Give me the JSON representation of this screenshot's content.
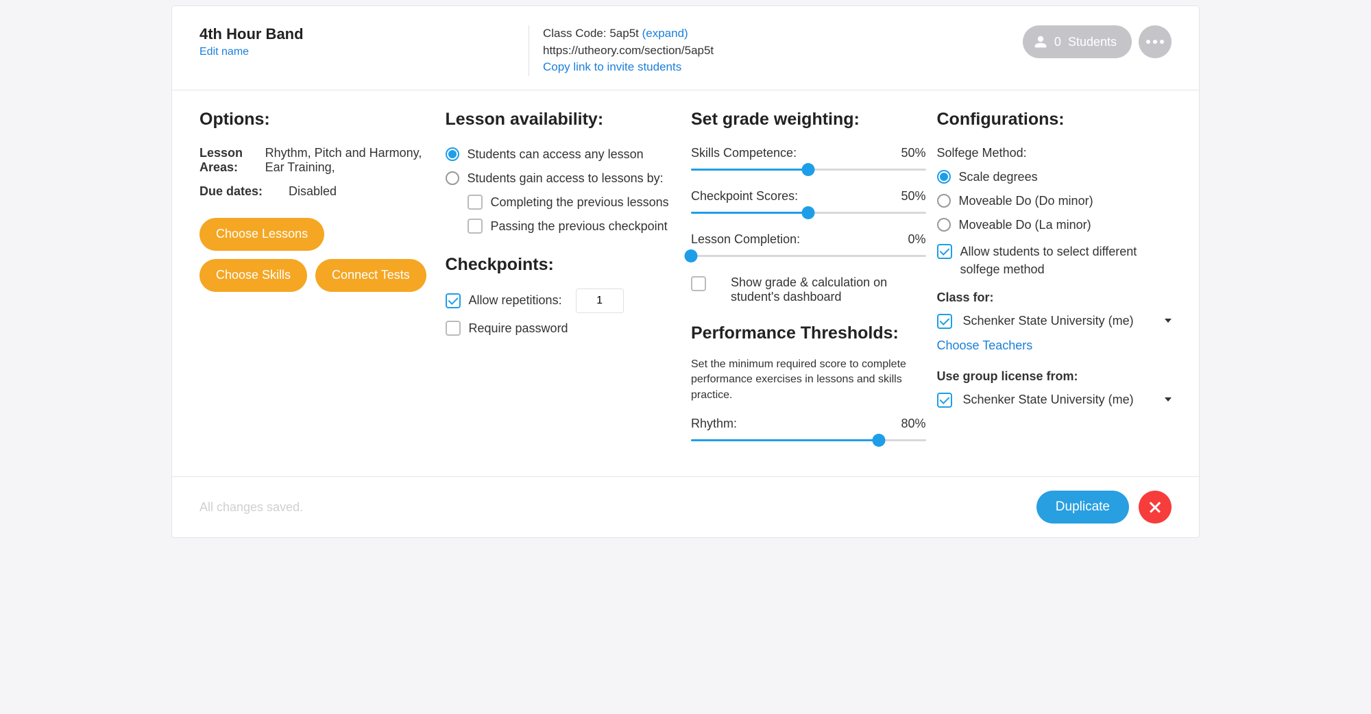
{
  "header": {
    "title": "4th Hour Band",
    "edit_name": "Edit name",
    "class_code_prefix": "Class Code: ",
    "class_code": "5ap5t",
    "expand": "(expand)",
    "url": "https://utheory.com/section/5ap5t",
    "copy_link": "Copy link to invite students",
    "students_count": "0",
    "students_label": "Students"
  },
  "options": {
    "heading": "Options:",
    "lesson_areas_label": "Lesson Areas:",
    "lesson_areas_value": "Rhythm, Pitch and Harmony, Ear Training,",
    "due_dates_label": "Due dates:",
    "due_dates_value": "Disabled",
    "choose_lessons": "Choose Lessons",
    "choose_skills": "Choose Skills",
    "connect_tests": "Connect Tests"
  },
  "availability": {
    "heading": "Lesson availability:",
    "opt_any": "Students can access any lesson",
    "opt_gain": "Students gain access to lessons by:",
    "sub_completing": "Completing the previous lessons",
    "sub_passing": "Passing the previous checkpoint",
    "checkpoints_heading": "Checkpoints:",
    "allow_repetitions": "Allow repetitions:",
    "repetitions_value": "1",
    "require_password": "Require password"
  },
  "grading": {
    "heading": "Set grade weighting:",
    "skills_label": "Skills Competence:",
    "skills_value": "50%",
    "skills_pct": 50,
    "checkpoint_label": "Checkpoint Scores:",
    "checkpoint_value": "50%",
    "checkpoint_pct": 50,
    "lesson_label": "Lesson Completion:",
    "lesson_value": "0%",
    "lesson_pct": 0,
    "show_grade": "Show grade & calculation on student's dashboard",
    "perf_heading": "Performance Thresholds:",
    "perf_desc": "Set the minimum required score to complete performance exercises in lessons and skills practice.",
    "rhythm_label": "Rhythm:",
    "rhythm_value": "80%",
    "rhythm_pct": 80
  },
  "config": {
    "heading": "Configurations:",
    "solfege_label": "Solfege Method:",
    "scale_degrees": "Scale degrees",
    "moveable_do_do": "Moveable Do (Do minor)",
    "moveable_do_la": "Moveable Do (La minor)",
    "allow_students": "Allow students to select different solfege method",
    "class_for_label": "Class for:",
    "class_for_value": "Schenker State University (me)",
    "choose_teachers": "Choose Teachers",
    "license_label": "Use group license from:",
    "license_value": "Schenker State University (me)"
  },
  "footer": {
    "saved": "All changes saved.",
    "duplicate": "Duplicate"
  }
}
